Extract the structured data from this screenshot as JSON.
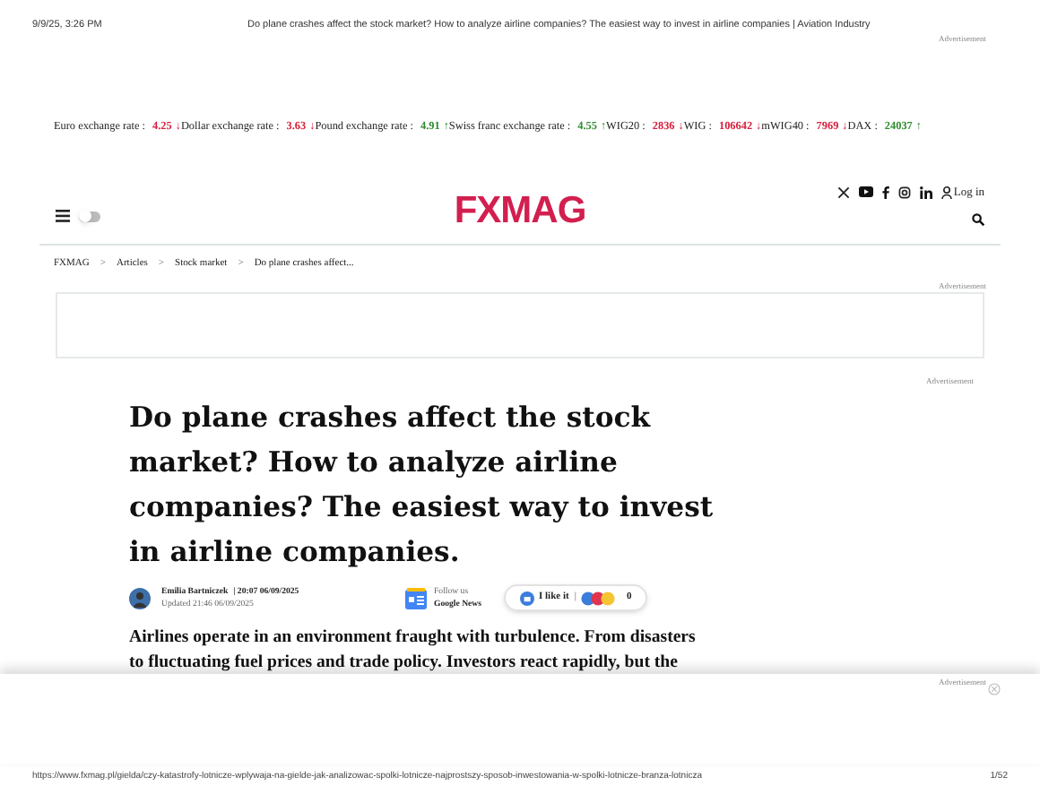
{
  "print_header": {
    "date": "9/9/25, 3:26 PM",
    "title": "Do plane crashes affect the stock market? How to analyze airline companies? The easiest way to invest in airline companies | Aviation Industry"
  },
  "top_ad_label": "Advertisement",
  "ticker": [
    {
      "label": "Euro exchange rate :",
      "value": "4.25",
      "arrow": "↓",
      "color": "#d6203d"
    },
    {
      "label": "Dollar exchange rate :",
      "value": "3.63",
      "arrow": "↓",
      "color": "#d6203d"
    },
    {
      "label": "Pound exchange rate :",
      "value": "4.91",
      "arrow": "↑",
      "color": "#2e8b2e"
    },
    {
      "label": "Swiss franc exchange rate :",
      "value": "4.55",
      "arrow": "↑",
      "color": "#2e8b2e"
    },
    {
      "label": "WIG20 :",
      "value": "2836",
      "arrow": "↓",
      "color": "#d6203d"
    },
    {
      "label": "WIG :",
      "value": "106642",
      "arrow": "↓",
      "color": "#d6203d"
    },
    {
      "label": "mWIG40 :",
      "value": "7969",
      "arrow": "↓",
      "color": "#d6203d"
    },
    {
      "label": "DAX :",
      "value": "24037",
      "arrow": "↑",
      "color": "#2e8b2e"
    }
  ],
  "header": {
    "logo": "FXMAG",
    "dark_mode_on": false,
    "login": "Log in"
  },
  "breadcrumbs": [
    "FXMAG",
    "Articles",
    "Stock market",
    "Do plane crashes affect..."
  ],
  "breadcrumb_separator": ">",
  "ad_labels": [
    "Advertisement",
    "Advertisement"
  ],
  "article": {
    "title": "Do plane crashes affect the stock market? How to analyze airline companies? The easiest way to invest in airline companies.",
    "author": "Emilia Bartniczek",
    "published": "| 20:07 06/09/2025",
    "updated": "Updated 21:46 06/09/2025",
    "follow_label": "Follow us",
    "follow_source": "Google News",
    "like_label": "I like it",
    "like_divider": "|",
    "reaction_count": "0",
    "lead": "Airlines operate in an environment fraught with turbulence. From disasters to fluctuating fuel prices and trade policy. Investors react rapidly, but the"
  },
  "bottom_ad_label": "Advertisement",
  "print_footer": {
    "url": "https://www.fxmag.pl/gielda/czy-katastrofy-lotnicze-wplywaja-na-gielde-jak-analizowac-spolki-lotnicze-najprostszy-sposob-inwestowania-w-spolki-lotnicze-branza-lotnicza",
    "page": "1/52"
  }
}
